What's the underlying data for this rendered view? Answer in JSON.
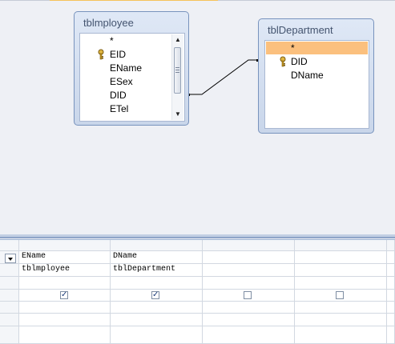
{
  "tables": [
    {
      "title": "tblmployee",
      "fields": [
        {
          "label": "*",
          "key": false
        },
        {
          "label": "EID",
          "key": true
        },
        {
          "label": "EName",
          "key": false
        },
        {
          "label": "ESex",
          "key": false
        },
        {
          "label": "DID",
          "key": false
        },
        {
          "label": "ETel",
          "key": false
        }
      ]
    },
    {
      "title": "tblDepartment",
      "fields": [
        {
          "label": "*",
          "key": false
        },
        {
          "label": "DID",
          "key": true
        },
        {
          "label": "DName",
          "key": false
        }
      ]
    }
  ],
  "grid": {
    "columns": [
      {
        "field": "EName",
        "table": "tblmployee",
        "show": true
      },
      {
        "field": "DName",
        "table": "tblDepartment",
        "show": true
      },
      {
        "field": "",
        "table": "",
        "show": false
      },
      {
        "field": "",
        "table": "",
        "show": false
      }
    ]
  },
  "colors": {
    "accent_tab": "#f5c25a",
    "selected_row": "#fbc07e"
  }
}
